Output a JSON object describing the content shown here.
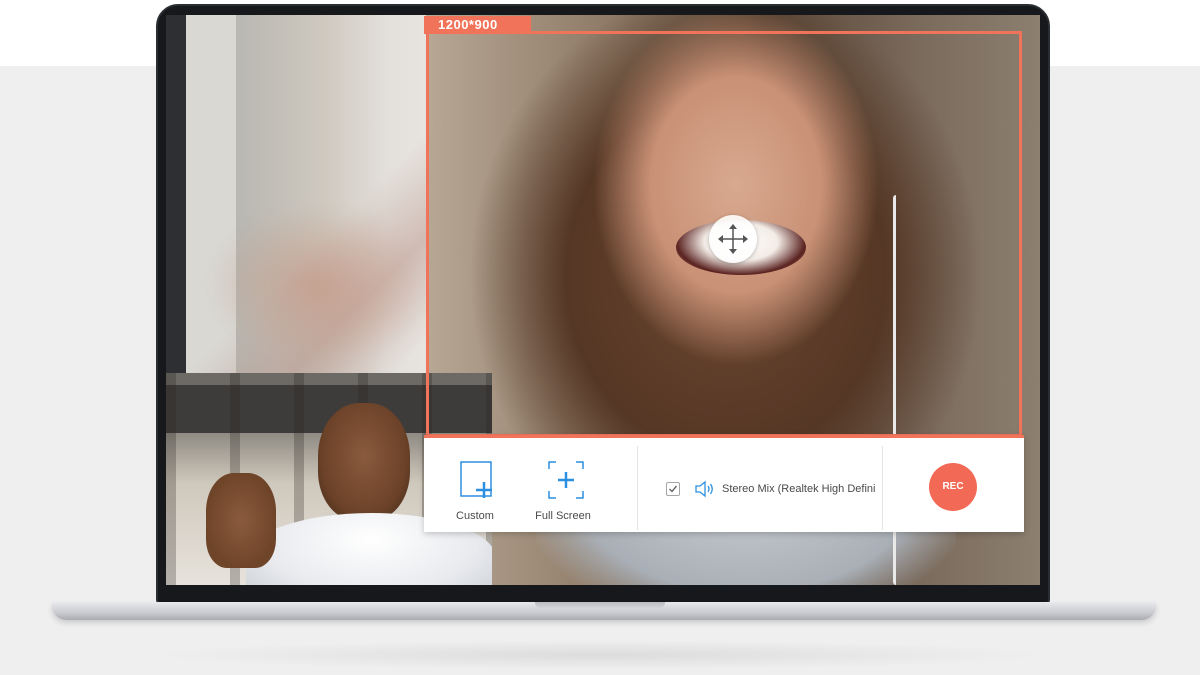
{
  "recording_area": {
    "size_label": "1200*900"
  },
  "toolbar": {
    "custom_label": "Custom",
    "full_screen_label": "Full Screen",
    "audio_source_label": "Stereo Mix (Realtek High Defini",
    "audio_enabled": true,
    "rec_label": "REC"
  },
  "icons": {
    "move": "move-arrows-icon",
    "custom": "custom-region-icon",
    "full_screen": "full-screen-region-icon",
    "speaker": "speaker-icon",
    "checkbox": "checkmark-icon"
  },
  "colors": {
    "accent": "#f0735a",
    "rec_button": "#f26a55",
    "icon_blue": "#2d8fe0"
  }
}
